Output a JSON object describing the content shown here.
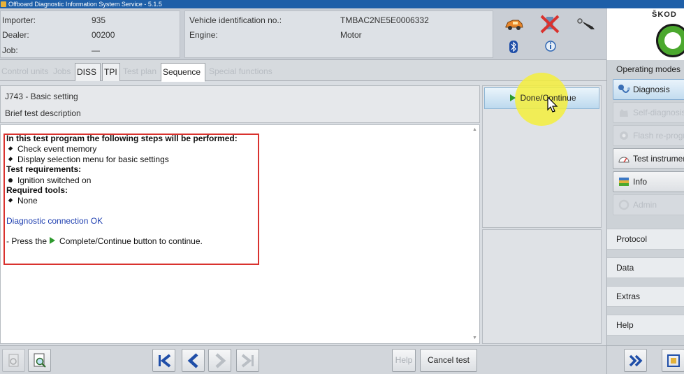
{
  "window": {
    "title": "Offboard Diagnostic Information System Service - 5.1.5"
  },
  "header": {
    "importer_label": "Importer:",
    "importer_value": "935",
    "dealer_label": "Dealer:",
    "dealer_value": "00200",
    "job_label": "Job:",
    "job_value": "—",
    "vin_label": "Vehicle identification no.:",
    "vin_value": "TMBAC2NE5E0006332",
    "engine_label": "Engine:",
    "engine_value": "Motor"
  },
  "brand": {
    "name": "ŠKOD"
  },
  "tabs": [
    {
      "label": "Control units",
      "state": "disabled"
    },
    {
      "label": "Jobs",
      "state": "disabled"
    },
    {
      "label": "DISS",
      "state": "enabled"
    },
    {
      "label": "TPI",
      "state": "enabled"
    },
    {
      "label": "Test plan",
      "state": "disabled"
    },
    {
      "label": "Sequence",
      "state": "active"
    },
    {
      "label": "Special functions",
      "state": "disabled"
    }
  ],
  "test": {
    "title": "J743 - Basic setting",
    "subtitle": "Brief test description",
    "intro": "In this test program the following steps will be performed:",
    "step1": "Check event memory",
    "step2": "Display selection menu for basic settings",
    "req_heading": "Test requirements:",
    "req1": "Ignition switched on",
    "tools_heading": "Required tools:",
    "tool1": "None",
    "connection_status": "Diagnostic connection OK",
    "instruction_prefix": "- Press the",
    "instruction_suffix": "Complete/Continue button to continue."
  },
  "actions": {
    "done_continue": "Done/Continue"
  },
  "bottom": {
    "help": "Help",
    "cancel_test": "Cancel test"
  },
  "sidebar": {
    "title": "Operating modes",
    "modes": [
      {
        "label": "Diagnosis",
        "state": "active"
      },
      {
        "label": "Self-diagnosis",
        "state": "disabled"
      },
      {
        "label": "Flash re-programming",
        "state": "disabled"
      },
      {
        "label": "Test instruments",
        "state": "enabled"
      },
      {
        "label": "Info",
        "state": "enabled"
      },
      {
        "label": "Admin",
        "state": "disabled"
      }
    ],
    "sections": [
      "Protocol",
      "Data",
      "Extras",
      "Help"
    ]
  },
  "colors": {
    "accent_blue": "#1e5fa8",
    "highlight_red": "#d9322e",
    "skoda_green": "#4ba82e",
    "action_green": "#2e9a2e",
    "link_blue": "#1f3fb0"
  }
}
